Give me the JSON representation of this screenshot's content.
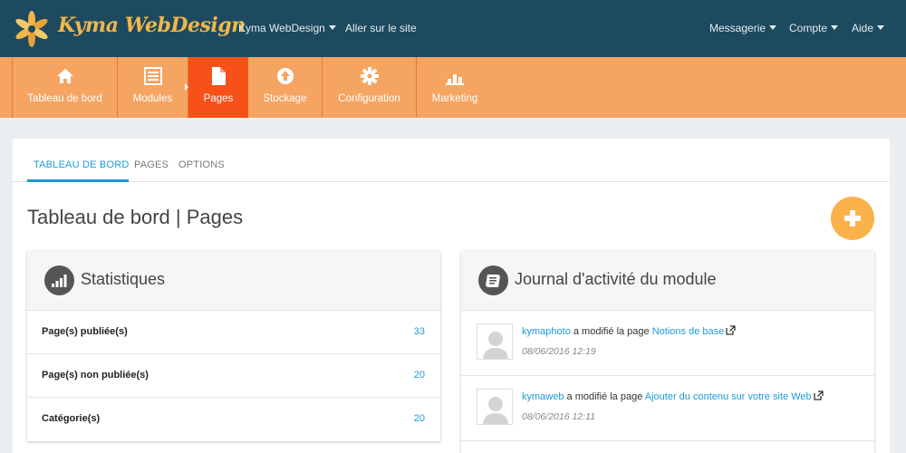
{
  "header": {
    "brand": "Kyma WebDesign",
    "nav_left": [
      {
        "label": "Kyma WebDesign",
        "dropdown": true
      },
      {
        "label": "Aller sur le site",
        "dropdown": false
      }
    ],
    "nav_right": [
      {
        "label": "Messagerie",
        "dropdown": true
      },
      {
        "label": "Compte",
        "dropdown": true
      },
      {
        "label": "Aide",
        "dropdown": true
      }
    ]
  },
  "main_nav": {
    "items": [
      {
        "label": "Tableau de bord",
        "icon": "home-icon"
      },
      {
        "label": "Modules",
        "icon": "list-icon"
      },
      {
        "label": "Pages",
        "icon": "file-icon",
        "active": true
      },
      {
        "label": "Stockage",
        "icon": "upload-icon"
      },
      {
        "label": "Configuration",
        "icon": "gear-icon"
      },
      {
        "label": "Marketing",
        "icon": "bar-chart-icon"
      }
    ]
  },
  "tabs": [
    {
      "label": "TABLEAU DE BORD",
      "active": true
    },
    {
      "label": "PAGES"
    },
    {
      "label": "OPTIONS"
    }
  ],
  "page_title": "Tableau de bord | Pages",
  "stats": {
    "title": "Statistiques",
    "rows": [
      {
        "label": "Page(s) publiée(s)",
        "value": "33"
      },
      {
        "label": "Page(s) non publiée(s)",
        "value": "20"
      },
      {
        "label": "Catégorie(s)",
        "value": "20"
      }
    ]
  },
  "activity": {
    "title": "Journal d'activité du module",
    "entries": [
      {
        "user": "kymaphoto",
        "action": "a modifié la page",
        "page": "Notions de base",
        "date": "08/06/2016 12:19"
      },
      {
        "user": "kymaweb",
        "action": "a modifié la page",
        "page": "Ajouter du contenu sur votre site Web",
        "date": "08/06/2016 12:11"
      }
    ]
  },
  "colors": {
    "topbar": "#1d4a5f",
    "orange_nav": "#f5a462",
    "active_nav": "#f55119",
    "accent": "#1d9ad6",
    "fab": "#fbb24a"
  }
}
